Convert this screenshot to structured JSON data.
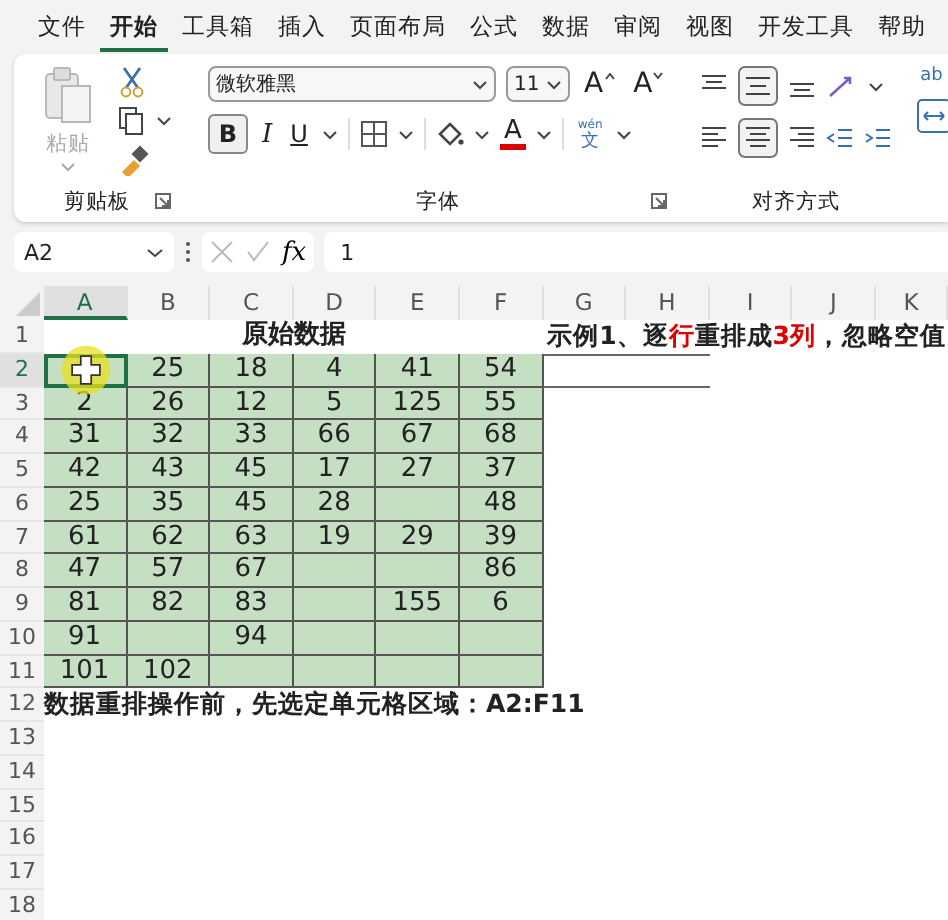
{
  "menu_tabs": [
    {
      "label": "文件",
      "selected": false
    },
    {
      "label": "开始",
      "selected": true
    },
    {
      "label": "工具箱",
      "selected": false
    },
    {
      "label": "插入",
      "selected": false
    },
    {
      "label": "页面布局",
      "selected": false
    },
    {
      "label": "公式",
      "selected": false
    },
    {
      "label": "数据",
      "selected": false
    },
    {
      "label": "审阅",
      "selected": false
    },
    {
      "label": "视图",
      "selected": false
    },
    {
      "label": "开发工具",
      "selected": false
    },
    {
      "label": "帮助",
      "selected": false
    }
  ],
  "ribbon": {
    "clipboard": {
      "paste_label": "粘贴",
      "group_label": "剪贴板"
    },
    "font": {
      "font_name": "微软雅黑",
      "font_size": "11",
      "grow_label": "A",
      "shrink_label": "A",
      "bold_label": "B",
      "bold_on": true,
      "italic_label": "I",
      "underline_label": "U",
      "font_color_label": "A",
      "phonetic_top": "wén",
      "phonetic_bottom": "文",
      "group_label": "字体"
    },
    "alignment": {
      "group_label": "对齐方式",
      "wrap_label": "ab"
    }
  },
  "formula_bar": {
    "name_box": "A2",
    "fx_label": "fx",
    "value": "1"
  },
  "sheet": {
    "columns": [
      {
        "label": "A",
        "selected": true
      },
      {
        "label": "B",
        "selected": false
      },
      {
        "label": "C",
        "selected": false
      },
      {
        "label": "D",
        "selected": false
      },
      {
        "label": "E",
        "selected": false
      },
      {
        "label": "F",
        "selected": false
      },
      {
        "label": "G",
        "selected": false
      },
      {
        "label": "H",
        "selected": false
      },
      {
        "label": "I",
        "selected": false
      },
      {
        "label": "J",
        "selected": false
      },
      {
        "label": "K",
        "selected": false
      }
    ],
    "row_numbers": [
      {
        "label": "1",
        "selected": false
      },
      {
        "label": "2",
        "selected": true
      },
      {
        "label": "3",
        "selected": false
      },
      {
        "label": "4",
        "selected": false
      },
      {
        "label": "5",
        "selected": false
      },
      {
        "label": "6",
        "selected": false
      },
      {
        "label": "7",
        "selected": false
      },
      {
        "label": "8",
        "selected": false
      },
      {
        "label": "9",
        "selected": false
      },
      {
        "label": "10",
        "selected": false
      },
      {
        "label": "11",
        "selected": false
      },
      {
        "label": "12",
        "selected": false
      },
      {
        "label": "13",
        "selected": false
      },
      {
        "label": "14",
        "selected": false
      },
      {
        "label": "15",
        "selected": false
      },
      {
        "label": "16",
        "selected": false
      },
      {
        "label": "17",
        "selected": false
      },
      {
        "label": "18",
        "selected": false
      }
    ],
    "table_title": "原始数据",
    "example_title": [
      {
        "text": "示例1、逐",
        "highlight": false
      },
      {
        "text": "行",
        "highlight": true
      },
      {
        "text": "重排成",
        "highlight": false
      },
      {
        "text": "3列",
        "highlight": true
      },
      {
        "text": "，忽略空值",
        "highlight": false
      }
    ],
    "data_rows": [
      [
        null,
        "25",
        "18",
        "4",
        "41",
        "54"
      ],
      [
        "2",
        "26",
        "12",
        "5",
        "125",
        "55"
      ],
      [
        "31",
        "32",
        "33",
        "66",
        "67",
        "68"
      ],
      [
        "42",
        "43",
        "45",
        "17",
        "27",
        "37"
      ],
      [
        "25",
        "35",
        "45",
        "28",
        null,
        "48"
      ],
      [
        "61",
        "62",
        "63",
        "19",
        "29",
        "39"
      ],
      [
        "47",
        "57",
        "67",
        null,
        null,
        "86"
      ],
      [
        "81",
        "82",
        "83",
        null,
        "155",
        "6"
      ],
      [
        "91",
        null,
        "94",
        null,
        null,
        null
      ],
      [
        "101",
        "102",
        null,
        null,
        null,
        null
      ]
    ],
    "note": "数据重排操作前，先选定单元格区域：A2:F11"
  }
}
